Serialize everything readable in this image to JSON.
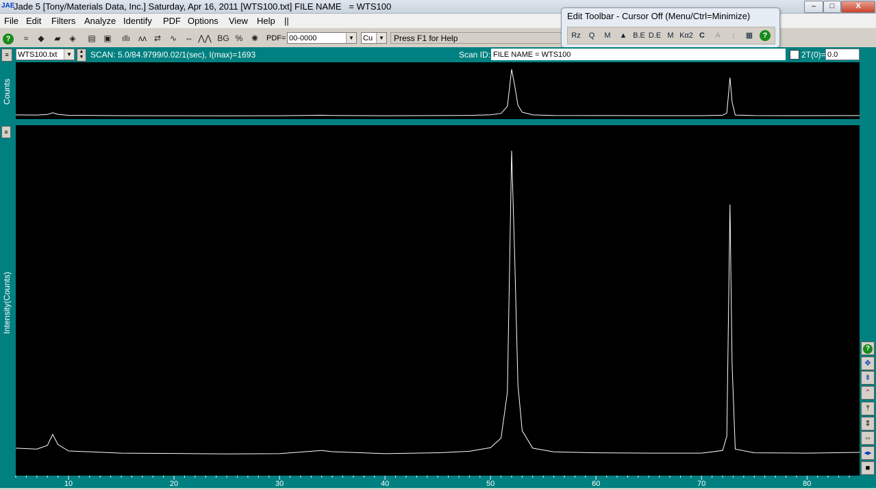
{
  "window": {
    "title": "Jade 5 [Tony/Materials Data, Inc.] Saturday, Apr 16, 2011 [WTS100.txt] FILE NAME   = WTS100",
    "logo": "JAE",
    "buttons": {
      "minimize": "–",
      "maximize": "□",
      "close": "X"
    }
  },
  "menu": [
    "File",
    "Edit",
    "Filters",
    "Analyze",
    "Identify",
    "PDF",
    "Options",
    "View",
    "Help",
    "||"
  ],
  "toolbar": {
    "pdf_label": "PDF=",
    "pdf_value": "00-0000",
    "anode_value": "Cu",
    "help_text": "Press F1 for Help"
  },
  "edit_toolbar": {
    "title": "Edit Toolbar - Cursor Off (Menu/Ctrl=Minimize)",
    "buttons": [
      "Rz",
      "Q",
      "M",
      "▲",
      "B.E",
      "D.E",
      "M",
      "Kα2",
      "C",
      "A",
      "↕",
      "▦",
      "?"
    ]
  },
  "infobar": {
    "file_value": "WTS100.txt",
    "scan_text": "SCAN: 5.0/84.9799/0.02/1(sec), I(max)=1693",
    "scan_id_label": "Scan ID:",
    "scan_id_value": "FILE NAME   = WTS100",
    "two_theta_label": "2T(0)=",
    "two_theta_value": "0.0"
  },
  "chart_data": [
    {
      "type": "line",
      "panel": "overview",
      "ylabel": "Counts",
      "xlim": [
        5,
        84.98
      ],
      "ylim": [
        0,
        1750
      ],
      "x": [
        5,
        7,
        8,
        8.5,
        9,
        10,
        15,
        20,
        25,
        30,
        34,
        35,
        40,
        45,
        48,
        50,
        51,
        51.6,
        52,
        52.3,
        52.6,
        53,
        54,
        56,
        60,
        65,
        70,
        72,
        72.4,
        72.7,
        72.9,
        73.2,
        75,
        80,
        84.98
      ],
      "y": [
        75,
        70,
        90,
        150,
        95,
        60,
        48,
        46,
        44,
        45,
        62,
        56,
        45,
        50,
        58,
        78,
        130,
        380,
        1693,
        1100,
        420,
        170,
        75,
        55,
        50,
        48,
        48,
        62,
        140,
        1400,
        530,
        70,
        50,
        48,
        52
      ]
    },
    {
      "type": "line",
      "panel": "main",
      "ylabel": "Intensity(Counts)",
      "xlim": [
        5,
        84.98
      ],
      "ylim": [
        0,
        1750
      ],
      "xticks": [
        10,
        20,
        30,
        40,
        50,
        60,
        70,
        80
      ],
      "x": [
        5,
        7,
        8,
        8.5,
        9,
        10,
        15,
        20,
        25,
        30,
        34,
        35,
        40,
        45,
        48,
        50,
        51,
        51.6,
        52,
        52.3,
        52.6,
        53,
        54,
        56,
        60,
        65,
        70,
        72,
        72.4,
        72.7,
        72.9,
        73.2,
        75,
        80,
        84.98
      ],
      "y": [
        75,
        70,
        90,
        150,
        95,
        60,
        48,
        46,
        44,
        45,
        62,
        56,
        45,
        50,
        58,
        78,
        130,
        380,
        1693,
        1100,
        420,
        170,
        75,
        55,
        50,
        48,
        48,
        62,
        140,
        1400,
        530,
        70,
        50,
        48,
        52
      ]
    }
  ],
  "colors": {
    "plot_bg": "#000000",
    "trace": "#ffffff",
    "frame": "#008080"
  }
}
